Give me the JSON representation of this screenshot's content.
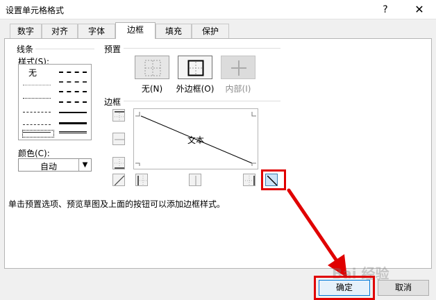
{
  "window": {
    "title": "设置单元格格式",
    "help_glyph": "?",
    "close_glyph": "✕"
  },
  "tabs": [
    {
      "label": "数字"
    },
    {
      "label": "对齐"
    },
    {
      "label": "字体"
    },
    {
      "label": "边框",
      "active": true
    },
    {
      "label": "填充"
    },
    {
      "label": "保护"
    }
  ],
  "line": {
    "group_label": "线条",
    "style_label": "样式(S):",
    "none_label": "无",
    "color_label": "颜色(C):",
    "color_value": "自动"
  },
  "presets": {
    "group_label": "预置",
    "none": "无(N)",
    "outline": "外边框(O)",
    "inside": "内部(I)"
  },
  "border": {
    "group_label": "边框",
    "preview_text": "文本"
  },
  "hint": "单击预置选项、预览草图及上面的按钮可以添加边框样式。",
  "buttons": {
    "ok": "确定",
    "cancel": "取消"
  },
  "watermark": "Bai 经验",
  "colors": {
    "highlight": "#e00000",
    "ok_border": "#0078d7"
  }
}
